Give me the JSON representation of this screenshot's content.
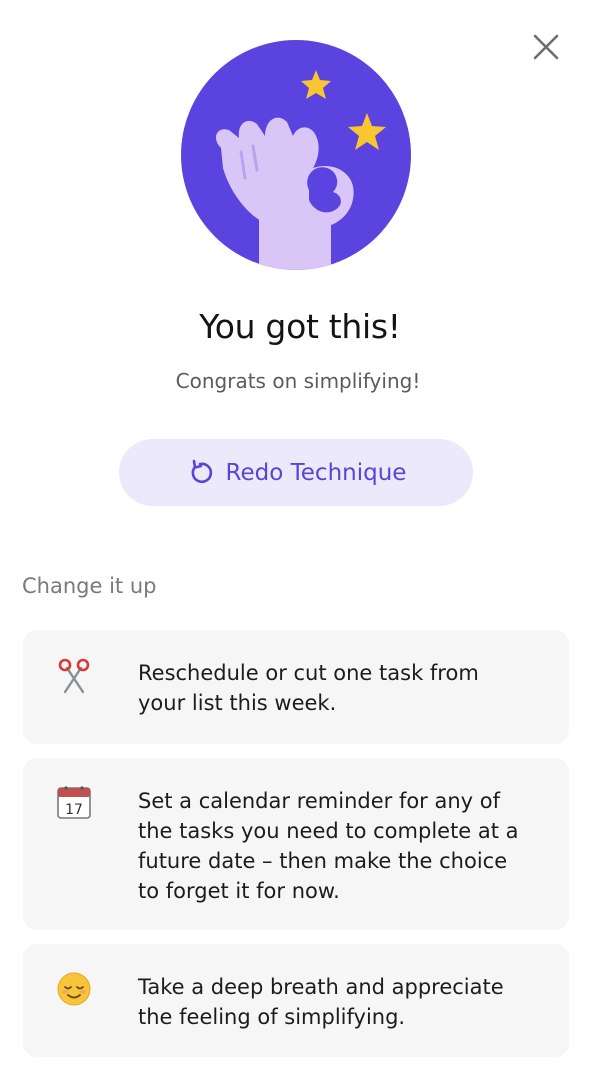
{
  "dialog": {
    "close_icon": "close-icon",
    "hero_icon": "ok-hand-with-stars-illustration",
    "title": "You got this!",
    "subtitle": "Congrats on simplifying!",
    "redo_button": {
      "icon": "redo-icon",
      "label": "Redo Technique"
    },
    "section_label": "Change it up",
    "tips": [
      {
        "icon": "scissors-icon",
        "text": "Reschedule or cut one task from\nyour list this week."
      },
      {
        "icon": "calendar-icon",
        "text": " Set a calendar reminder for any of\nthe tasks you need to complete at a\nfuture date – then make the choice\nto forget it for now."
      },
      {
        "icon": "relieved-face-icon",
        "text": "Take a deep breath and appreciate\nthe feeling of simplifying."
      }
    ]
  },
  "colors": {
    "accent": "#5b43d8",
    "hero_circle": "#5b43e0",
    "hand": "#d9c6f7",
    "star": "#f8c630",
    "button_bg": "#ece9fb",
    "card_bg": "#f6f6f6"
  }
}
